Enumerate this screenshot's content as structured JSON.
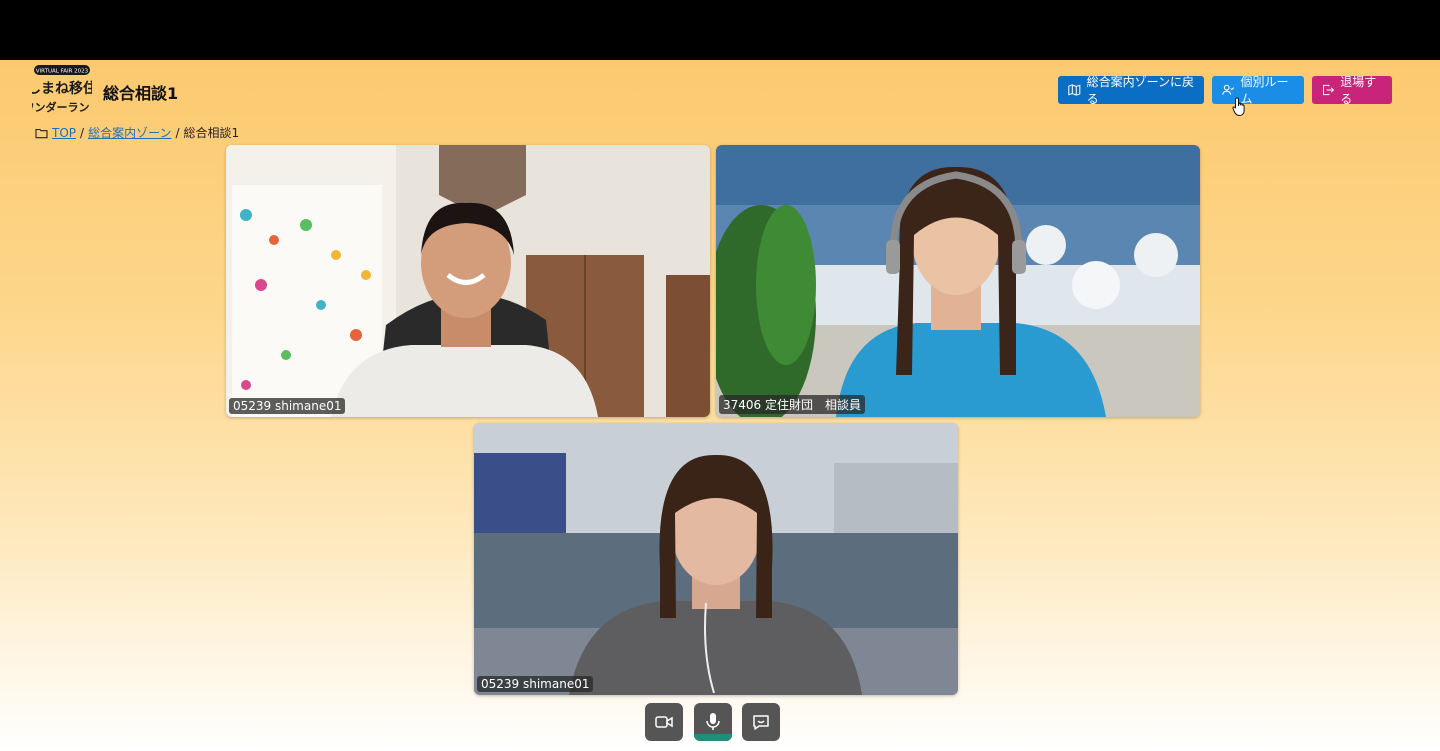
{
  "header": {
    "logo_line1": "VIRTUAL FAIR 2023",
    "logo_line2": "しまね移住",
    "logo_line3": "ワンダーランド",
    "room_title": "総合相談1",
    "back_button": "総合案内ゾーンに戻る",
    "private_room_button": "個別ルーム",
    "exit_button": "退場する"
  },
  "breadcrumb": {
    "top": "TOP",
    "zone": "総合案内ゾーン",
    "current": "総合相談1",
    "separator": "/"
  },
  "videos": [
    {
      "label": "05239 shimane01"
    },
    {
      "label": "37406 定住財団　相談員"
    },
    {
      "label": "05239 shimane01"
    }
  ],
  "controls": {
    "camera_icon": "video-camera-icon",
    "mic_icon": "microphone-icon",
    "chat_icon": "chat-bubble-icon",
    "mic_active_color": "#1f8f7a"
  },
  "colors": {
    "back_button": "#0a6fc4",
    "private_room_button": "#1a8ee6",
    "exit_button": "#c8247a"
  }
}
